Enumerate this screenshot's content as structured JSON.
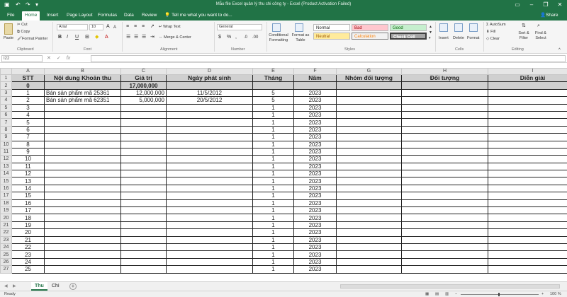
{
  "app": {
    "title": "Mẫu file Excel quản lý thu chi công ty - Excel (Product Activation Failed)",
    "save_icon": "save-icon",
    "undo_icon": "undo-icon",
    "redo_icon": "redo-icon",
    "accent_color": "#217346"
  },
  "menu": {
    "tabs": [
      "File",
      "Home",
      "Insert",
      "Page Layout",
      "Formulas",
      "Data",
      "Review",
      "View"
    ],
    "active_tab": "Home",
    "tell_me": "Tell me what you want to do...",
    "share": "Share"
  },
  "ribbon": {
    "clipboard": {
      "paste": "Paste",
      "cut": "Cut",
      "copy": "Copy",
      "format_painter": "Format Painter",
      "group": "Clipboard"
    },
    "font": {
      "name": "Arial",
      "size": "10",
      "bold": "B",
      "italic": "I",
      "underline": "U",
      "group": "Font"
    },
    "alignment": {
      "wrap": "Wrap Text",
      "merge": "Merge & Center",
      "group": "Alignment"
    },
    "number": {
      "format": "General",
      "currency": "$",
      "percent": "%",
      "comma": ",",
      "group": "Number"
    },
    "styles": {
      "conditional": "Conditional Formatting",
      "format_table": "Format as Table",
      "normal": "Normal",
      "bad": "Bad",
      "good": "Good",
      "neutral": "Neutral",
      "calculation": "Calculation",
      "check_cell": "Check Cell",
      "group": "Styles"
    },
    "cells": {
      "insert": "Insert",
      "delete": "Delete",
      "format": "Format",
      "group": "Cells"
    },
    "editing": {
      "autosum": "AutoSum",
      "fill": "Fill",
      "clear": "Clear",
      "sort": "Sort & Filter",
      "find": "Find & Select",
      "group": "Editing"
    }
  },
  "formula_bar": {
    "name_box": "I22",
    "cancel": "✕",
    "enter": "✓",
    "fx": "fx",
    "value": ""
  },
  "grid": {
    "columns": [
      "A",
      "B",
      "C",
      "D",
      "E",
      "F",
      "G",
      "H",
      "I"
    ],
    "headers": [
      "STT",
      "Nội dung Khoản thu",
      "Giá trị",
      "Ngày phát sinh",
      "Tháng",
      "Năm",
      "Nhóm đối tượng",
      "Đối tượng",
      "Diễn giải"
    ],
    "rows": [
      [
        "0",
        "",
        "17,000,000",
        "",
        "",
        "",
        "",
        "",
        ""
      ],
      [
        "1",
        "Bán sản phẩm mã 25361",
        "12,000,000",
        "11/5/2012",
        "5",
        "2023",
        "",
        "",
        ""
      ],
      [
        "2",
        "Bán sản phẩm mã 62351",
        "5,000,000",
        "20/5/2012",
        "5",
        "2023",
        "",
        "",
        ""
      ],
      [
        "3",
        "",
        "",
        "",
        "1",
        "2023",
        "",
        "",
        ""
      ],
      [
        "4",
        "",
        "",
        "",
        "1",
        "2023",
        "",
        "",
        ""
      ],
      [
        "5",
        "",
        "",
        "",
        "1",
        "2023",
        "",
        "",
        ""
      ],
      [
        "6",
        "",
        "",
        "",
        "1",
        "2023",
        "",
        "",
        ""
      ],
      [
        "7",
        "",
        "",
        "",
        "1",
        "2023",
        "",
        "",
        ""
      ],
      [
        "8",
        "",
        "",
        "",
        "1",
        "2023",
        "",
        "",
        ""
      ],
      [
        "9",
        "",
        "",
        "",
        "1",
        "2023",
        "",
        "",
        ""
      ],
      [
        "10",
        "",
        "",
        "",
        "1",
        "2023",
        "",
        "",
        ""
      ],
      [
        "11",
        "",
        "",
        "",
        "1",
        "2023",
        "",
        "",
        ""
      ],
      [
        "12",
        "",
        "",
        "",
        "1",
        "2023",
        "",
        "",
        ""
      ],
      [
        "13",
        "",
        "",
        "",
        "1",
        "2023",
        "",
        "",
        ""
      ],
      [
        "14",
        "",
        "",
        "",
        "1",
        "2023",
        "",
        "",
        ""
      ],
      [
        "15",
        "",
        "",
        "",
        "1",
        "2023",
        "",
        "",
        ""
      ],
      [
        "16",
        "",
        "",
        "",
        "1",
        "2023",
        "",
        "",
        ""
      ],
      [
        "17",
        "",
        "",
        "",
        "1",
        "2023",
        "",
        "",
        ""
      ],
      [
        "18",
        "",
        "",
        "",
        "1",
        "2023",
        "",
        "",
        ""
      ],
      [
        "19",
        "",
        "",
        "",
        "1",
        "2023",
        "",
        "",
        ""
      ],
      [
        "20",
        "",
        "",
        "",
        "1",
        "2023",
        "",
        "",
        ""
      ],
      [
        "21",
        "",
        "",
        "",
        "1",
        "2023",
        "",
        "",
        ""
      ],
      [
        "22",
        "",
        "",
        "",
        "1",
        "2023",
        "",
        "",
        ""
      ],
      [
        "23",
        "",
        "",
        "",
        "1",
        "2023",
        "",
        "",
        ""
      ],
      [
        "24",
        "",
        "",
        "",
        "1",
        "2023",
        "",
        "",
        ""
      ],
      [
        "25",
        "",
        "",
        "",
        "1",
        "2023",
        "",
        "",
        ""
      ]
    ]
  },
  "sheets": {
    "tabs": [
      "Thu",
      "Chi"
    ],
    "active": "Thu",
    "add": "+"
  },
  "status": {
    "ready": "Ready",
    "zoom": "100 %"
  }
}
